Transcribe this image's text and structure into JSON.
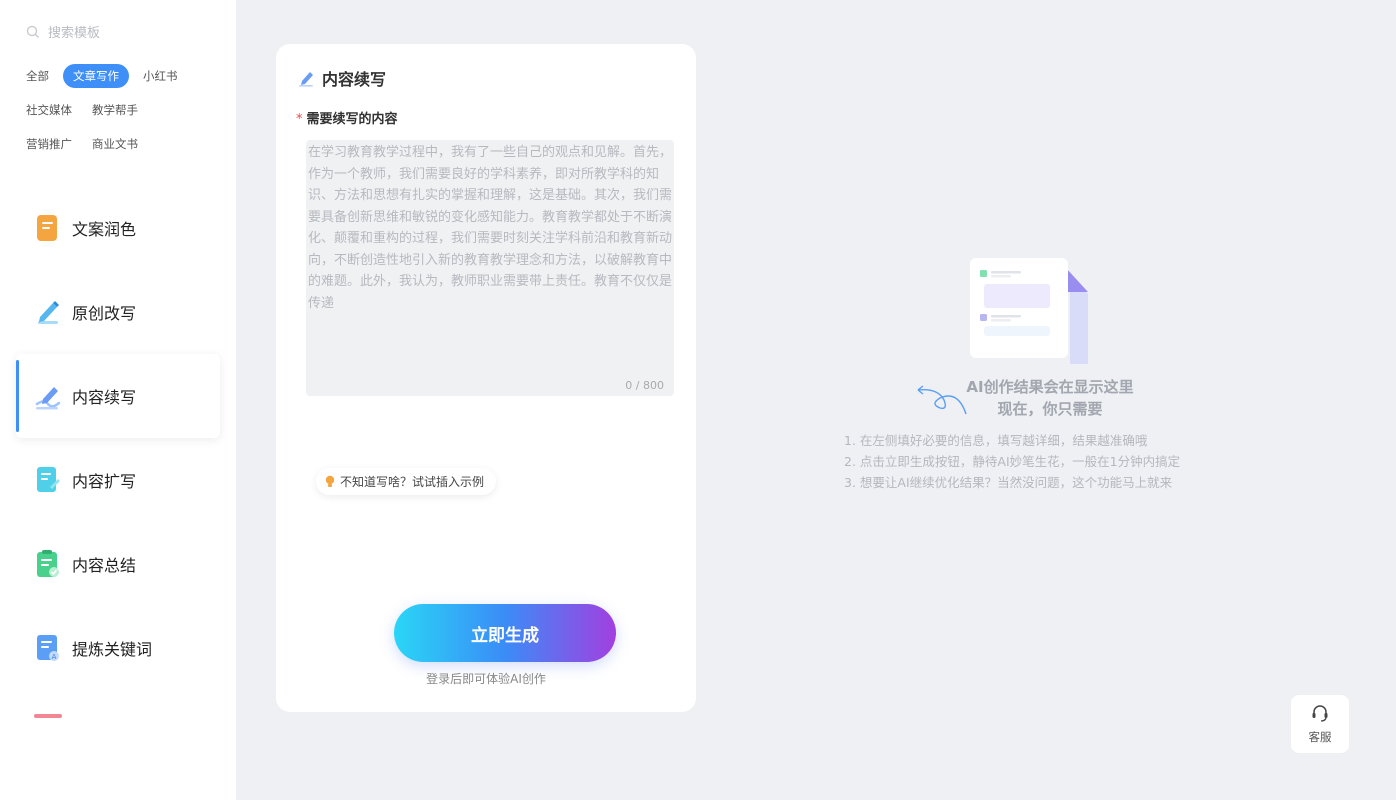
{
  "search": {
    "placeholder": "搜索模板"
  },
  "categories": [
    {
      "label": "全部",
      "active": false
    },
    {
      "label": "文章写作",
      "active": true
    },
    {
      "label": "小红书",
      "active": false
    },
    {
      "label": "社交媒体",
      "active": false
    },
    {
      "label": "教学帮手",
      "active": false
    },
    {
      "label": "营销推广",
      "active": false
    },
    {
      "label": "商业文书",
      "active": false
    }
  ],
  "menu": [
    {
      "label": "文案润色",
      "icon": "doc-orange-icon",
      "color": "#f5a540"
    },
    {
      "label": "原创改写",
      "icon": "pencil-blue-icon",
      "color": "#55b6f0"
    },
    {
      "label": "内容续写",
      "icon": "pen-continue-icon",
      "color": "#6a9cf5",
      "active": true
    },
    {
      "label": "内容扩写",
      "icon": "doc-expand-icon",
      "color": "#4fd0e8"
    },
    {
      "label": "内容总结",
      "icon": "doc-summary-icon",
      "color": "#48d08c"
    },
    {
      "label": "提炼关键词",
      "icon": "doc-keyword-icon",
      "color": "#5a9ef5"
    }
  ],
  "form": {
    "title": "内容续写",
    "field_label": "需要续写的内容",
    "required_mark": "*",
    "placeholder": "在学习教育教学过程中，我有了一些自己的观点和见解。首先，作为一个教师，我们需要良好的学科素养，即对所教学科的知识、方法和思想有扎实的掌握和理解，这是基础。其次，我们需要具备创新思维和敏锐的变化感知能力。教育教学都处于不断演化、颠覆和重构的过程，我们需要时刻关注学科前沿和教育新动向，不断创造性地引入新的教育教学理念和方法，以破解教育中的难题。此外，我认为，教师职业需要带上责任。教育不仅仅是传递",
    "counter": "0 / 800",
    "hint": "不知道写啥？试试插入示例",
    "generate_label": "立即生成",
    "login_note": "登录后即可体验AI创作"
  },
  "empty_state": {
    "title_line1": "AI创作结果会在显示这里",
    "title_line2": "现在，你只需要",
    "steps": [
      "1. 在左侧填好必要的信息，填写越详细，结果越准确哦",
      "2. 点击立即生成按钮，静待AI妙笔生花，一般在1分钟内搞定",
      "3. 想要让AI继续优化结果？当然没问题，这个功能马上就来"
    ]
  },
  "service": {
    "label": "客服"
  },
  "colors": {
    "accent": "#3e8ff7",
    "gradient_start": "#2ad6f6",
    "gradient_end": "#a23fe0"
  }
}
